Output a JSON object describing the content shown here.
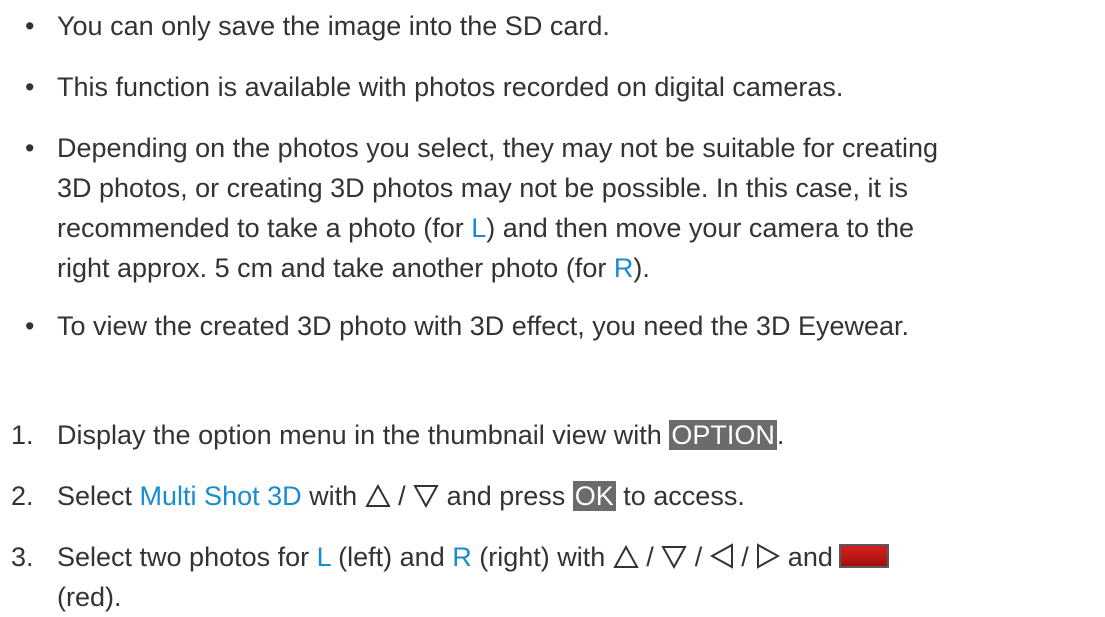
{
  "bullets": {
    "symbol": "•",
    "b1": "You can only save the image into the SD card.",
    "b2": "This function is available with photos recorded on digital cameras.",
    "b3": {
      "line1": "Depending on the photos you select, they may not be suitable for creating",
      "line2": "3D photos, or creating 3D photos may not be possible. In this case, it is",
      "line3_pre": "recommended to take a photo (for ",
      "L": "L",
      "line3_post": ") and then move your camera to the",
      "line4_pre": "right approx. 5 cm and take another photo (for ",
      "R": "R",
      "line4_post": ")."
    },
    "b4": "To view the created 3D photo with 3D effect, you need the 3D Eyewear."
  },
  "steps": {
    "s1": {
      "num": "1.",
      "pre": "Display the option menu in the thumbnail view with ",
      "key": "OPTION",
      "post": "."
    },
    "s2": {
      "num": "2.",
      "pre": "Select ",
      "link": "Multi Shot 3D",
      "mid": " with ",
      "sep": " / ",
      "mid2": " and press ",
      "key": "OK",
      "post": " to access."
    },
    "s3": {
      "num": "3.",
      "pre": "Select two photos for ",
      "L": "L",
      "mid1": " (left) and ",
      "R": "R",
      "mid2": " (right) with ",
      "sep": " / ",
      "and": " and",
      "line2": "(red)."
    }
  },
  "icons": {
    "up": "up-triangle-icon",
    "down": "down-triangle-icon",
    "left": "left-triangle-icon",
    "right": "right-triangle-icon",
    "red": "red-button-icon"
  },
  "colors": {
    "text": "#333333",
    "link": "#1a8ad4",
    "key_bg": "#6b6b6b",
    "red_button": "#c41414"
  }
}
